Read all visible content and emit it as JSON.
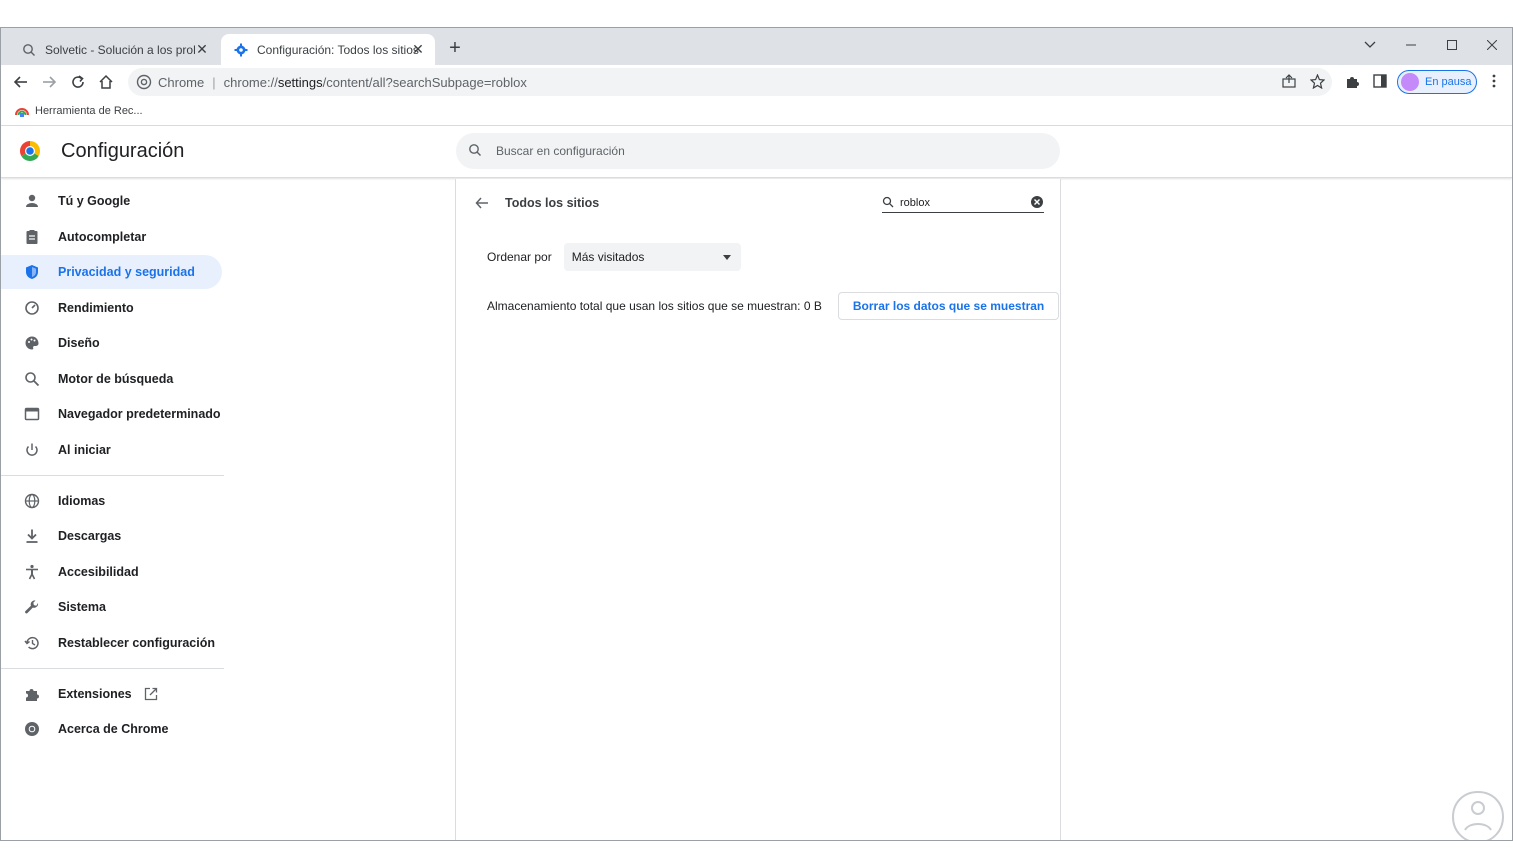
{
  "tabs": [
    {
      "title": "Solvetic - Solución a los problem",
      "favicon": "search-favicon"
    },
    {
      "title": "Configuración: Todos los sitios",
      "favicon": "gear-favicon"
    }
  ],
  "toolbar": {
    "omnibox_chip": "Chrome",
    "url_prefix": "chrome://",
    "url_host": "settings",
    "url_path": "/content/all?searchSubpage=roblox",
    "profile_label": "En pausa"
  },
  "bookmarks": [
    {
      "label": "Herramienta de Rec..."
    }
  ],
  "header": {
    "title": "Configuración",
    "search_placeholder": "Buscar en configuración"
  },
  "sidebar": {
    "items": [
      {
        "label": "Tú y Google",
        "icon": "person-icon"
      },
      {
        "label": "Autocompletar",
        "icon": "clipboard-icon"
      },
      {
        "label": "Privacidad y seguridad",
        "icon": "shield-icon"
      },
      {
        "label": "Rendimiento",
        "icon": "speedometer-icon"
      },
      {
        "label": "Diseño",
        "icon": "palette-icon"
      },
      {
        "label": "Motor de búsqueda",
        "icon": "search-icon"
      },
      {
        "label": "Navegador predeterminado",
        "icon": "browser-icon"
      },
      {
        "label": "Al iniciar",
        "icon": "power-icon"
      },
      {
        "label": "Idiomas",
        "icon": "globe-icon"
      },
      {
        "label": "Descargas",
        "icon": "download-icon"
      },
      {
        "label": "Accesibilidad",
        "icon": "accessibility-icon"
      },
      {
        "label": "Sistema",
        "icon": "wrench-icon"
      },
      {
        "label": "Restablecer configuración",
        "icon": "history-icon"
      },
      {
        "label": "Extensiones",
        "icon": "puzzle-icon"
      },
      {
        "label": "Acerca de Chrome",
        "icon": "chrome-icon"
      }
    ],
    "active_index": 2
  },
  "main": {
    "title": "Todos los sitios",
    "filter_value": "roblox",
    "sort_label": "Ordenar por",
    "sort_value": "Más visitados",
    "storage_text": "Almacenamiento total que usan los sitios que se muestran: 0 B",
    "clear_button": "Borrar los datos que se muestran"
  },
  "colors": {
    "accent": "#1a73e8",
    "active_bg": "#e8f0fe",
    "tabstrip": "#dee1e6",
    "omnibox": "#f1f3f4"
  }
}
